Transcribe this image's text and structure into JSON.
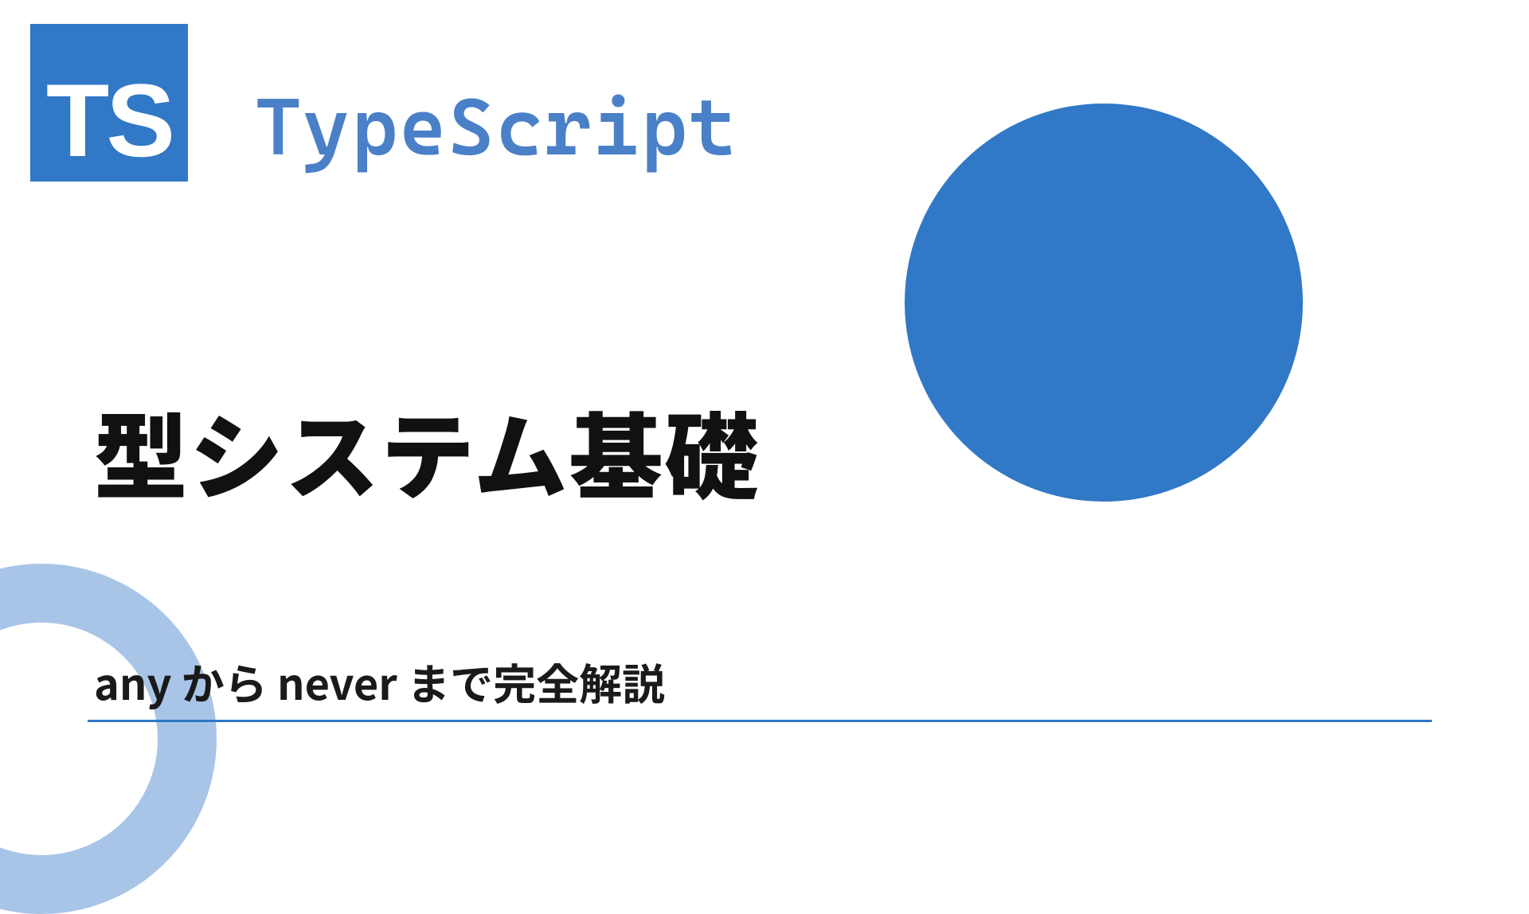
{
  "logo": {
    "text": "TS"
  },
  "brand": "TypeScript",
  "title": "型システム基礎",
  "subtitle": "any から never まで完全解説"
}
